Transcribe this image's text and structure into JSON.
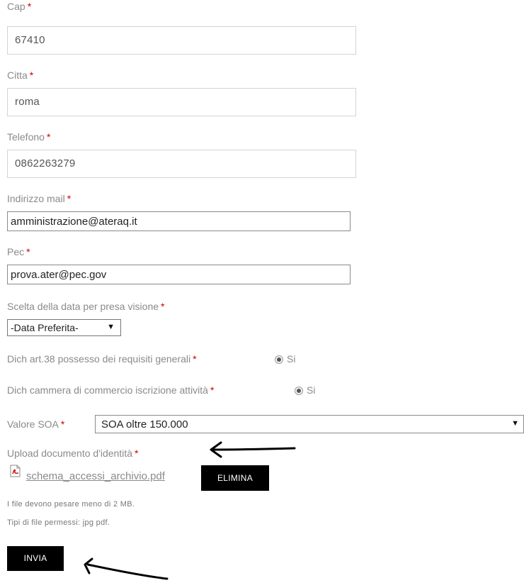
{
  "form": {
    "cap": {
      "label": "Cap",
      "required_mark": "*",
      "value": "67410"
    },
    "citta": {
      "label": "Citta",
      "required_mark": "*",
      "value": "roma"
    },
    "telefono": {
      "label": "Telefono",
      "required_mark": "*",
      "value": "0862263279"
    },
    "email": {
      "label": "Indirizzo mail",
      "required_mark": "*",
      "value": "amministrazione@ateraq.it"
    },
    "pec": {
      "label": "Pec",
      "required_mark": "*",
      "value": "prova.ater@pec.gov"
    },
    "data_visione": {
      "label": "Scelta della data per presa visione",
      "required_mark": "*",
      "selected": "-Data Preferita-"
    },
    "dich_art38": {
      "label": "Dich art.38 possesso dei requisiti generali",
      "required_mark": "*",
      "option": "Si",
      "checked": true
    },
    "dich_camera": {
      "label": "Dich cammera di commercio iscrizione attività",
      "required_mark": "*",
      "option": "Si",
      "checked": true
    },
    "valore_soa": {
      "label": "Valore SOA",
      "required_mark": "*",
      "selected": "SOA oltre 150.000"
    },
    "upload": {
      "label": "Upload documento d'identità",
      "required_mark": "*",
      "file_name": "schema_accessi_archivio.pdf",
      "delete_label": "ELIMINA",
      "note_size": "I file devono pesare meno di 2 MB.",
      "note_types": "Tipi di file permessi: jpg pdf."
    },
    "submit_label": "INVIA"
  },
  "icons": {
    "pdf": "pdf-file-icon",
    "select_arrow": "dropdown-arrow-icon",
    "annotation_arrow": "hand-drawn-arrow"
  },
  "colors": {
    "required": "#cc0000",
    "button_bg": "#000000",
    "button_text": "#ffffff",
    "label": "#8a8a8a"
  }
}
